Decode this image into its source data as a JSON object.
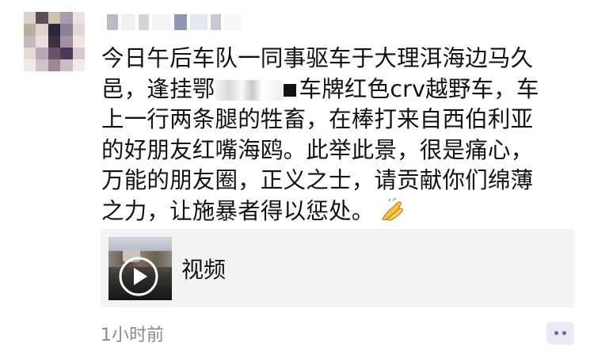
{
  "post": {
    "avatar_alt": "blurred profile picture",
    "nickname_hidden": true,
    "text_lines": [
      "今日午后车队一同事驱车于大理洱海边马久",
      "邑，逢挂鄂",
      "车牌红色crv越野车，车",
      "上一行两条腿的牲畜，在棒打来自西伯利亚",
      "的好朋友红嘴海鸥。此举此景，很是痛心，",
      "万能的朋友圈，正义之士，请贡献你们绵薄",
      "之力，让施暴者得以惩处。"
    ],
    "emoji": "folded-hands-icon"
  },
  "video": {
    "label": "视频",
    "icon": "play-icon"
  },
  "footer": {
    "timestamp": "1小时前",
    "comment_icon": "comment-dots-icon"
  },
  "colors": {
    "text": "#111111",
    "timestamp": "#8a8a8a",
    "card_bg": "#f3f3f3",
    "comment_dot": "#5d6f92"
  }
}
